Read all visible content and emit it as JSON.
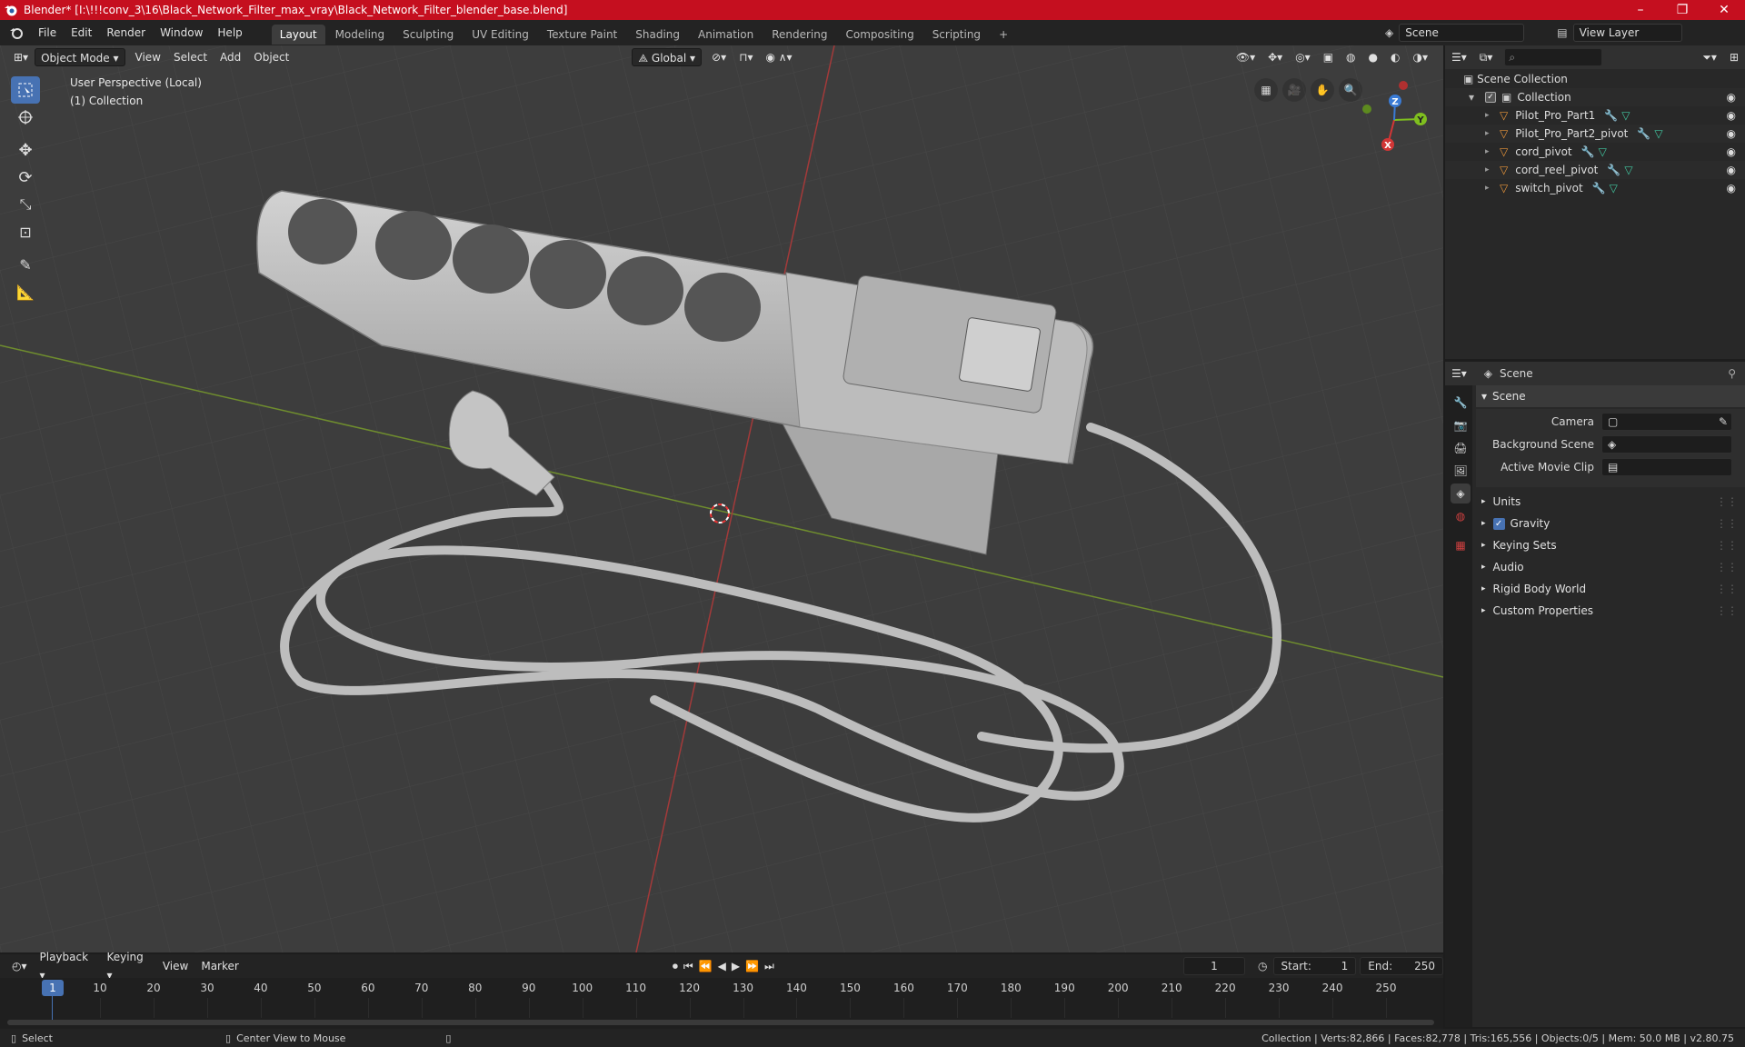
{
  "window": {
    "title": "Blender* [I:\\!!!conv_3\\16\\Black_Network_Filter_max_vray\\Black_Network_Filter_blender_base.blend]",
    "minimize": "–",
    "restore": "❐",
    "close": "✕"
  },
  "menus": [
    "File",
    "Edit",
    "Render",
    "Window",
    "Help"
  ],
  "workspaces": [
    "Layout",
    "Modeling",
    "Sculpting",
    "UV Editing",
    "Texture Paint",
    "Shading",
    "Animation",
    "Rendering",
    "Compositing",
    "Scripting"
  ],
  "workspace_add": "+",
  "scene_name": "Scene",
  "view_layer": "View Layer",
  "viewport": {
    "mode": "Object Mode",
    "menus": [
      "View",
      "Select",
      "Add",
      "Object"
    ],
    "orientation": "Global",
    "perspective_label": "User Perspective (Local)",
    "collection_label": "(1) Collection",
    "gizmo": {
      "x": "X",
      "y": "Y",
      "z": "Z"
    },
    "colors": {
      "x_axis": "#d23636",
      "y_axis": "#7fbf1f",
      "z_axis": "#3a7bd5"
    }
  },
  "outliner": {
    "search_placeholder": "",
    "root": "Scene Collection",
    "collection": "Collection",
    "items": [
      "Pilot_Pro_Part1",
      "Pilot_Pro_Part2_pivot",
      "cord_pivot",
      "cord_reel_pivot",
      "switch_pivot"
    ]
  },
  "properties": {
    "context": "Scene",
    "panel_title": "Scene",
    "fields": [
      {
        "label": "Camera",
        "value": ""
      },
      {
        "label": "Background Scene",
        "value": ""
      },
      {
        "label": "Active Movie Clip",
        "value": ""
      }
    ],
    "subpanels": [
      "Units",
      "Gravity",
      "Keying Sets",
      "Audio",
      "Rigid Body World",
      "Custom Properties"
    ],
    "gravity_checked": true
  },
  "timeline": {
    "menus": [
      "Playback",
      "Keying",
      "View",
      "Marker"
    ],
    "current_frame": "1",
    "start_label": "Start:",
    "start": "1",
    "end_label": "End:",
    "end": "250",
    "ticks": [
      "10",
      "20",
      "30",
      "40",
      "50",
      "60",
      "70",
      "80",
      "90",
      "100",
      "110",
      "120",
      "130",
      "140",
      "150",
      "160",
      "170",
      "180",
      "190",
      "200",
      "210",
      "220",
      "230",
      "240",
      "250"
    ],
    "playhead": "1"
  },
  "statusbar": {
    "select": "Select",
    "center": "Center View to Mouse",
    "stats": "Collection | Verts:82,866 | Faces:82,778 | Tris:165,556 | Objects:0/5 | Mem: 50.0 MB | v2.80.75"
  }
}
